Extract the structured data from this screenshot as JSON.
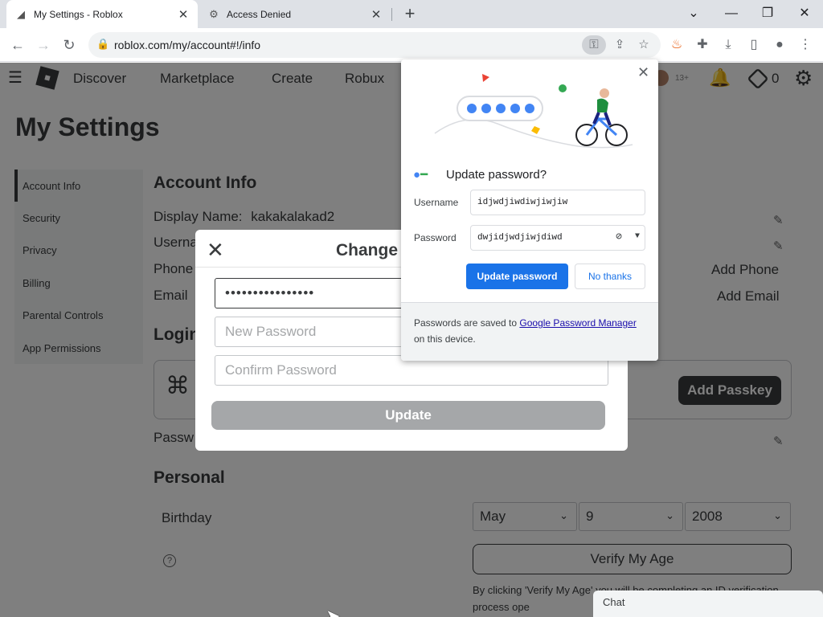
{
  "browser": {
    "tabs": [
      {
        "title": "My Settings - Roblox",
        "active": true
      },
      {
        "title": "Access Denied",
        "active": false
      }
    ],
    "url": "roblox.com/my/account#!/info",
    "window_controls": [
      "chevron-down",
      "minimize",
      "restore",
      "close"
    ]
  },
  "nav": {
    "links": [
      "Discover",
      "Marketplace",
      "Create",
      "Robux"
    ],
    "age_badge": "13+",
    "robux_count": "0"
  },
  "page": {
    "title": "My Settings",
    "sidebar": [
      {
        "label": "Account Info",
        "active": true
      },
      {
        "label": "Security",
        "active": false
      },
      {
        "label": "Privacy",
        "active": false
      },
      {
        "label": "Billing",
        "active": false
      },
      {
        "label": "Parental Controls",
        "active": false
      },
      {
        "label": "App Permissions",
        "active": false
      }
    ],
    "account_info": {
      "title": "Account Info",
      "display_name_label": "Display Name:",
      "display_name_value": "kakakalakad2",
      "username_label": "Userna",
      "phone_label": "Phone",
      "email_label": "Email",
      "add_phone": "Add Phone",
      "add_email": "Add Email"
    },
    "login": {
      "title": "Login",
      "add_passkey": "Add Passkey",
      "password_label": "Passw"
    },
    "personal": {
      "title": "Personal",
      "birthday_label": "Birthday",
      "birthday_month": "May",
      "birthday_day": "9",
      "birthday_year": "2008",
      "verify_button": "Verify My Age",
      "verify_text": "By clicking 'Verify My Age' you will be completing an ID verification process ope"
    },
    "chat_label": "Chat"
  },
  "modal": {
    "title": "Change",
    "current_password_masked": "••••••••••••••••",
    "new_password_placeholder": "New Password",
    "confirm_password_placeholder": "Confirm Password",
    "update_button": "Update"
  },
  "password_bubble": {
    "title": "Update password?",
    "username_label": "Username",
    "username_value": "idjwdjiwdiwjiwjiw",
    "password_label": "Password",
    "password_value": "dwjidjwdjiwjdiwd",
    "update_button": "Update password",
    "no_thanks_button": "No thanks",
    "footer_prefix": "Passwords are saved to ",
    "footer_link": "Google Password Manager",
    "footer_suffix": " on this device."
  },
  "colors": {
    "roblox_text": "#393b3d",
    "chrome_blue": "#1a73e8",
    "disabled_button": "#a5a7a9"
  }
}
